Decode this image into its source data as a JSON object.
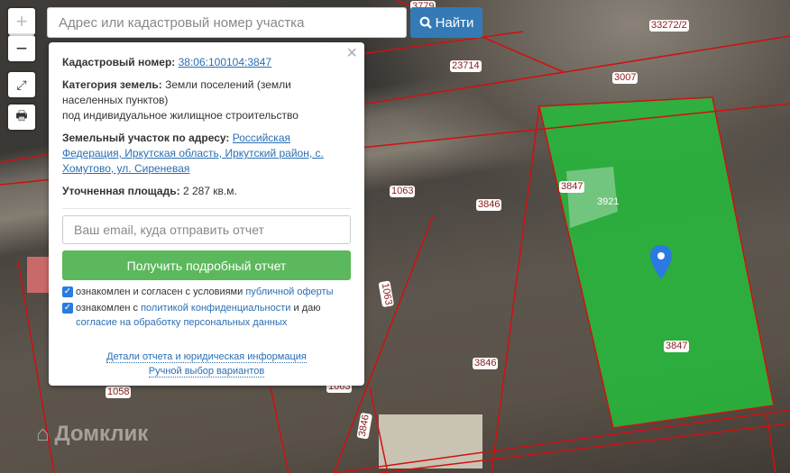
{
  "search": {
    "placeholder": "Адрес или кадастровый номер участка",
    "button": "Найти"
  },
  "controls": {
    "zoom_in": "+",
    "zoom_out": "−"
  },
  "popup": {
    "cadastral_label": "Кадастровый номер:",
    "cadastral_value": "38:06:100104:3847",
    "category_label": "Категория земель:",
    "category_value": "Земли поселений (земли населенных пунктов)",
    "category_use": "под индивидуальное жилищное строительство",
    "address_label": "Земельный участок по адресу:",
    "address_value": "Российская Федерация, Иркутская область, Иркутский район, с. Хомутово, ул. Сиреневая",
    "area_label": "Уточненная площадь:",
    "area_value": "2 287 кв.м.",
    "email_placeholder": "Ваш email, куда отправить отчет",
    "get_report": "Получить подробный отчет",
    "consent1_text": "ознакомлен и согласен с условиями ",
    "consent1_link": "публичной оферты",
    "consent2_text": "ознакомлен с ",
    "consent2_link": "политикой конфиденциальности",
    "consent2_mid": " и даю ",
    "consent2_link2": "согласие на обработку персональных данных",
    "details_link": "Детали отчета и юридическая информация",
    "manual_link": "Ручной выбор вариантов"
  },
  "parcels": [
    "3779",
    "33272/2",
    "23714",
    "3007",
    "3847",
    "3921",
    "1063",
    "3846",
    "1063",
    "3846",
    "1058",
    "1063",
    "3846",
    "3847"
  ],
  "watermark": "Домклик",
  "colors": {
    "parcel_fill": "#22c13a",
    "boundary": "#d01010",
    "accent": "#337ab7",
    "green_button": "#5cb85c"
  }
}
